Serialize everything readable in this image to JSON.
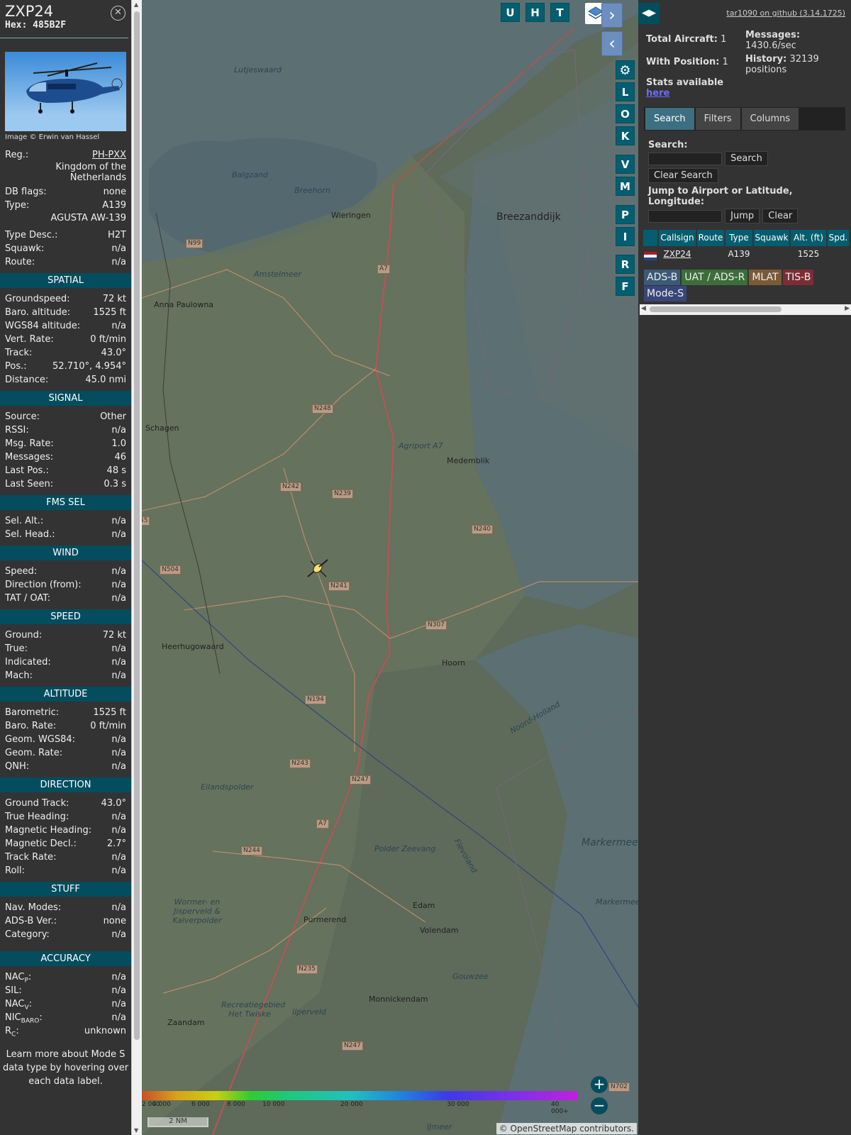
{
  "aircraft": {
    "callsign": "ZXP24",
    "hex_label": "Hex:",
    "hex": "485B2F",
    "image_credit": "Image © Erwin van Hassel",
    "reg_label": "Reg.:",
    "reg": "PH-PXX",
    "country": "Kingdom of the Netherlands",
    "fields_top": [
      {
        "label": "DB flags:",
        "value": "none"
      },
      {
        "label": "Type:",
        "value": "A139"
      }
    ],
    "type_full": "AGUSTA AW-139",
    "fields_mid": [
      {
        "label": "Type Desc.:",
        "value": "H2T"
      },
      {
        "label": "Squawk:",
        "value": "n/a"
      },
      {
        "label": "Route:",
        "value": "n/a"
      }
    ]
  },
  "sections": [
    {
      "title": "SPATIAL",
      "rows": [
        {
          "label": "Groundspeed:",
          "value": "72 kt"
        },
        {
          "label": "Baro. altitude:",
          "value": "1525 ft"
        },
        {
          "label": "WGS84 altitude:",
          "value": "n/a"
        },
        {
          "label": "Vert. Rate:",
          "value": "0 ft/min"
        },
        {
          "label": "Track:",
          "value": "43.0°"
        },
        {
          "label": "Pos.:",
          "value": "52.710°, 4.954°"
        },
        {
          "label": "Distance:",
          "value": "45.0 nmi"
        }
      ]
    },
    {
      "title": "SIGNAL",
      "rows": [
        {
          "label": "Source:",
          "value": "Other"
        },
        {
          "label": "RSSI:",
          "value": "n/a"
        },
        {
          "label": "Msg. Rate:",
          "value": "1.0"
        },
        {
          "label": "Messages:",
          "value": "46"
        },
        {
          "label": "Last Pos.:",
          "value": "48 s"
        },
        {
          "label": "Last Seen:",
          "value": "0.3 s"
        }
      ]
    },
    {
      "title": "FMS SEL",
      "rows": [
        {
          "label": "Sel. Alt.:",
          "value": "n/a"
        },
        {
          "label": "Sel. Head.:",
          "value": "n/a"
        }
      ]
    },
    {
      "title": "WIND",
      "rows": [
        {
          "label": "Speed:",
          "value": "n/a"
        },
        {
          "label": "Direction (from):",
          "value": "n/a"
        },
        {
          "label": "TAT / OAT:",
          "value": "n/a"
        }
      ]
    },
    {
      "title": "SPEED",
      "rows": [
        {
          "label": "Ground:",
          "value": "72 kt"
        },
        {
          "label": "True:",
          "value": "n/a"
        },
        {
          "label": "Indicated:",
          "value": "n/a"
        },
        {
          "label": "Mach:",
          "value": "n/a"
        }
      ]
    },
    {
      "title": "ALTITUDE",
      "rows": [
        {
          "label": "Barometric:",
          "value": "1525 ft"
        },
        {
          "label": "Baro. Rate:",
          "value": "0 ft/min"
        },
        {
          "label": "Geom. WGS84:",
          "value": "n/a"
        },
        {
          "label": "Geom. Rate:",
          "value": "n/a"
        },
        {
          "label": "QNH:",
          "value": "n/a"
        }
      ]
    },
    {
      "title": "DIRECTION",
      "rows": [
        {
          "label": "Ground Track:",
          "value": "43.0°"
        },
        {
          "label": "True Heading:",
          "value": "n/a"
        },
        {
          "label": "Magnetic Heading:",
          "value": "n/a"
        },
        {
          "label": "Magnetic Decl.:",
          "value": "2.7°"
        },
        {
          "label": "Track Rate:",
          "value": "n/a"
        },
        {
          "label": "Roll:",
          "value": "n/a"
        }
      ]
    },
    {
      "title": "STUFF",
      "rows": [
        {
          "label": "Nav. Modes:",
          "value": "n/a"
        },
        {
          "label": "ADS-B Ver.:",
          "value": "none"
        },
        {
          "label": "Category:",
          "value": "n/a"
        }
      ]
    },
    {
      "title": "ACCURACY",
      "rows": [
        {
          "label": "NAC",
          "sub": "P",
          "value": "n/a"
        },
        {
          "label": "SIL:",
          "value": "n/a"
        },
        {
          "label": "NAC",
          "sub": "V",
          "value": "n/a"
        },
        {
          "label": "NIC",
          "sub": "BARO",
          "value": "n/a"
        },
        {
          "label": "R",
          "sub": "C",
          "value": "unknown"
        }
      ]
    }
  ],
  "learn_more": "Learn more about Mode S data type by hovering over each data label.",
  "map": {
    "tool_buttons_top": [
      "U",
      "H",
      "T"
    ],
    "tool_buttons_side": [
      "L",
      "O",
      "K",
      "V",
      "M",
      "P",
      "I",
      "R",
      "F"
    ],
    "places": [
      {
        "name": "Lutjeswaard",
        "cls": "water"
      },
      {
        "name": "Balgzand",
        "cls": "water"
      },
      {
        "name": "Breehorn",
        "cls": "water"
      },
      {
        "name": "Wieringen",
        "cls": ""
      },
      {
        "name": "Breezanddijk",
        "cls": "big"
      },
      {
        "name": "Amstelmeer",
        "cls": "water"
      },
      {
        "name": "Anna Paulowna",
        "cls": ""
      },
      {
        "name": "Schagen",
        "cls": ""
      },
      {
        "name": "Medemblik",
        "cls": ""
      },
      {
        "name": "Agriport A7",
        "cls": "water"
      },
      {
        "name": "Heerhugowaard",
        "cls": ""
      },
      {
        "name": "Hoorn",
        "cls": ""
      },
      {
        "name": "Noord-Holland",
        "cls": "water"
      },
      {
        "name": "Eilandspolder",
        "cls": "water"
      },
      {
        "name": "Polder Zeevang",
        "cls": "water"
      },
      {
        "name": "Edam",
        "cls": ""
      },
      {
        "name": "Volendam",
        "cls": ""
      },
      {
        "name": "Purmerend",
        "cls": ""
      },
      {
        "name": "Markermeer",
        "cls": "big water"
      },
      {
        "name": "Markermeer & IJmeer",
        "cls": "water"
      },
      {
        "name": "Monnickendam",
        "cls": ""
      },
      {
        "name": "Zaandam",
        "cls": ""
      },
      {
        "name": "Flevoland",
        "cls": "water"
      },
      {
        "name": "Wormer- en Jisperveld & Kalverpolder",
        "cls": "water"
      },
      {
        "name": "Recreatiegebied Het Twiske",
        "cls": "water"
      },
      {
        "name": "Ilperveld",
        "cls": "water"
      },
      {
        "name": "Gouwzee",
        "cls": "water"
      },
      {
        "name": "IJmeer",
        "cls": "water"
      }
    ],
    "roads": [
      "N99",
      "A7",
      "N248",
      "N242",
      "N239",
      "N240",
      "N504",
      "N241",
      "N307",
      "N194",
      "N243",
      "N247",
      "A7",
      "N244",
      "N235",
      "N247",
      "45",
      "N702"
    ],
    "legend_ticks": [
      "2 000",
      "4 000",
      "6 000",
      "8 000",
      "10 000",
      "20 000",
      "30 000",
      "40 000+"
    ],
    "scale_label": "2 NM",
    "attribution_link": "© OpenStreetMap",
    "attribution_text": " contributors."
  },
  "side": {
    "toggle_icon": "◀▶",
    "github": "tar1090 on github (3.14.1725)",
    "total_aircraft_label": "Total Aircraft:",
    "total_aircraft": "1",
    "with_position_label": "With Position:",
    "with_position": "1",
    "messages_label": "Messages:",
    "messages": "1430.6/sec",
    "history_label": "History:",
    "history": "32139 positions",
    "stats_label": "Stats available",
    "stats_link": "here",
    "tabs": [
      "Search",
      "Filters",
      "Columns"
    ],
    "search_label": "Search:",
    "search_button": "Search",
    "clear_search_button": "Clear Search",
    "jump_label": "Jump to Airport or Latitude, Longitude:",
    "jump_button": "Jump",
    "clear_button": "Clear",
    "columns": [
      "",
      "Callsign",
      "Route",
      "Type",
      "Squawk",
      "Alt. (ft)",
      "Spd."
    ],
    "rows": [
      {
        "callsign": "ZXP24",
        "route": "",
        "type": "A139",
        "squawk": "",
        "alt": "1525",
        "spd": ""
      }
    ],
    "badges": [
      {
        "label": "ADS-B",
        "color": "#3a5a77"
      },
      {
        "label": "UAT / ADS-R",
        "color": "#3c6e3a"
      },
      {
        "label": "MLAT",
        "color": "#7a5b36"
      },
      {
        "label": "TIS-B",
        "color": "#7a2e34"
      },
      {
        "label": "Mode-S",
        "color": "#38467a"
      }
    ]
  }
}
